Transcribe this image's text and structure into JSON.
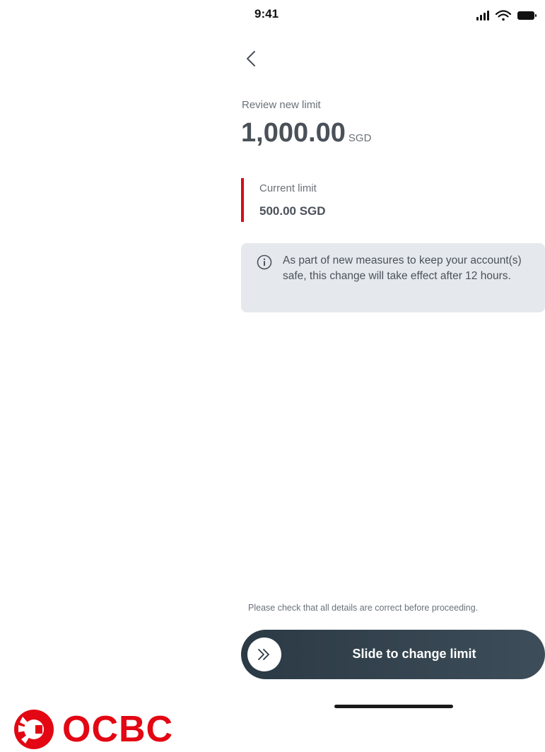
{
  "status_bar": {
    "time": "9:41",
    "icons": [
      "signal-icon",
      "wifi-icon",
      "battery-icon"
    ]
  },
  "header": {
    "back_icon": "chevron-left-icon"
  },
  "review": {
    "label": "Review new limit",
    "amount": "1,000.00",
    "currency": "SGD"
  },
  "current": {
    "label": "Current limit",
    "value": "500.00 SGD"
  },
  "info": {
    "icon": "info-icon",
    "text": "As part of new measures to keep your account(s) safe, this change will take effect after 12 hours."
  },
  "footer": {
    "note": "Please check that all details are correct before proceeding.",
    "slider_label": "Slide to change limit",
    "slider_icon": "double-chevron-right-icon"
  },
  "brand": {
    "name": "OCBC",
    "color": "#e30613"
  },
  "colors": {
    "accent_red": "#d50b1c",
    "slider_bg": "#2b3a45",
    "info_bg": "#e5e9ed",
    "text_primary": "#4a5159"
  }
}
